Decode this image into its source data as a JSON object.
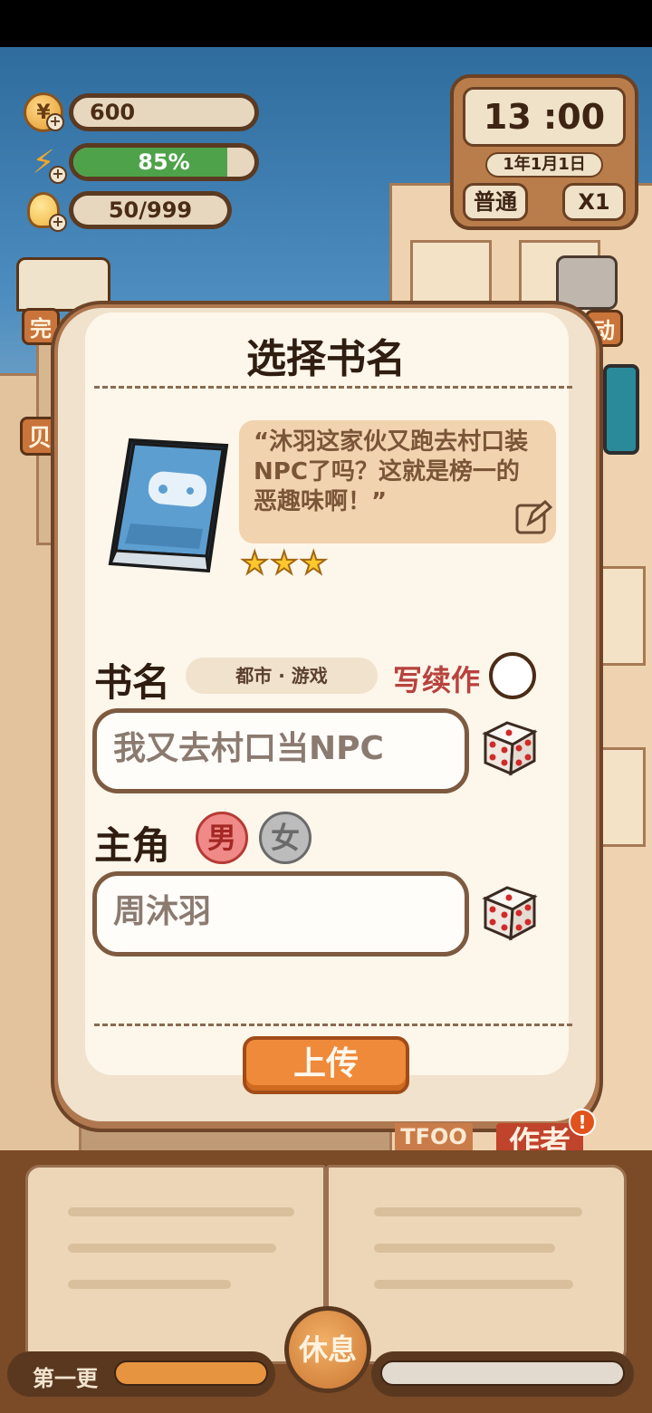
{
  "hud": {
    "coins": {
      "value": "600",
      "icon": "coin-icon"
    },
    "energy": {
      "value": "85%",
      "percent": 85,
      "icon": "lightning-icon"
    },
    "ideas": {
      "value": "50/999",
      "icon": "lightbulb-icon"
    }
  },
  "clock": {
    "time": "13 :00",
    "date": "1年1月1日",
    "mode": "普通",
    "speed": "X1"
  },
  "side": {
    "left_label": "完",
    "right_label": "动",
    "left_lower": "贝"
  },
  "dialog": {
    "title": "选择书名",
    "quote": "“沐羽这家伙又跑去村口装NPC了吗？这就是榜一的恶趣味啊！”",
    "stars": 3,
    "book_name_label": "书名",
    "genre": "都市 · 游戏",
    "sequel_label": "写续作",
    "book_name_value": "我又去村口当NPC",
    "protagonist_label": "主角",
    "gender_male": "男",
    "gender_female": "女",
    "protagonist_value": "周沐羽",
    "upload_label": "上传"
  },
  "bottom": {
    "chapter_label": "第一更",
    "rest_label": "休息",
    "author_tag": "作者",
    "sign_tag": "TFOO",
    "alert": "!"
  },
  "colors": {
    "accent": "#ee8a3a",
    "energy_fill": "#4ea24a",
    "sequel_text": "#b8423e"
  }
}
